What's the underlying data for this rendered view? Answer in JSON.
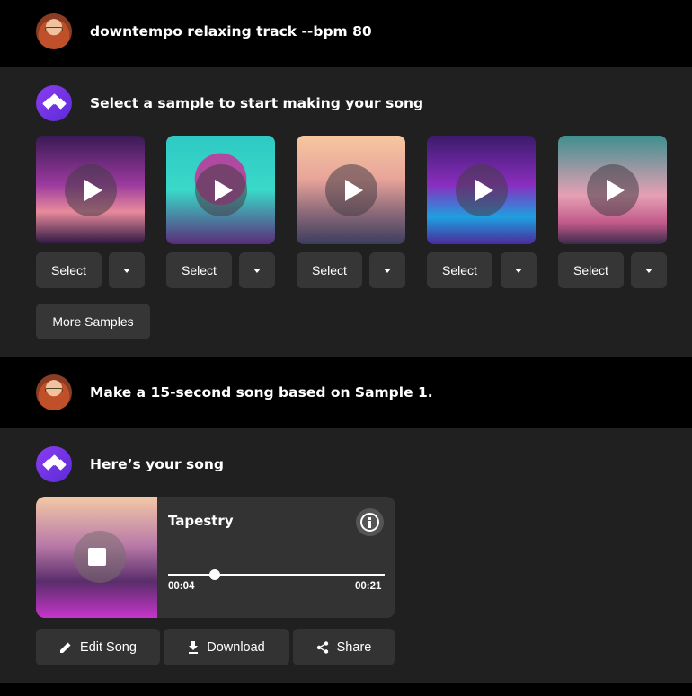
{
  "messages": {
    "user_prompt_1": "downtempo relaxing track --bpm 80",
    "bot_reply_1": "Select a sample to start making your song",
    "user_prompt_2": "Make a 15-second song based on Sample 1.",
    "bot_reply_2": "Here’s your song"
  },
  "samples": [
    {
      "select_label": "Select"
    },
    {
      "select_label": "Select"
    },
    {
      "select_label": "Select"
    },
    {
      "select_label": "Select"
    },
    {
      "select_label": "Select"
    }
  ],
  "more_samples_label": "More Samples",
  "player": {
    "track_title": "Tapestry",
    "elapsed": "00:04",
    "duration": "00:21",
    "progress": 0.21
  },
  "actions": {
    "edit": "Edit Song",
    "download": "Download",
    "share": "Share"
  },
  "icons": [
    "user-avatar",
    "bot-logo-icon",
    "play-icon",
    "chevron-down-icon",
    "stop-icon",
    "info-icon",
    "pencil-icon",
    "download-icon",
    "share-icon"
  ],
  "colors": {
    "accent": "#7a3ae8",
    "background": "#202020",
    "button": "#363636"
  }
}
